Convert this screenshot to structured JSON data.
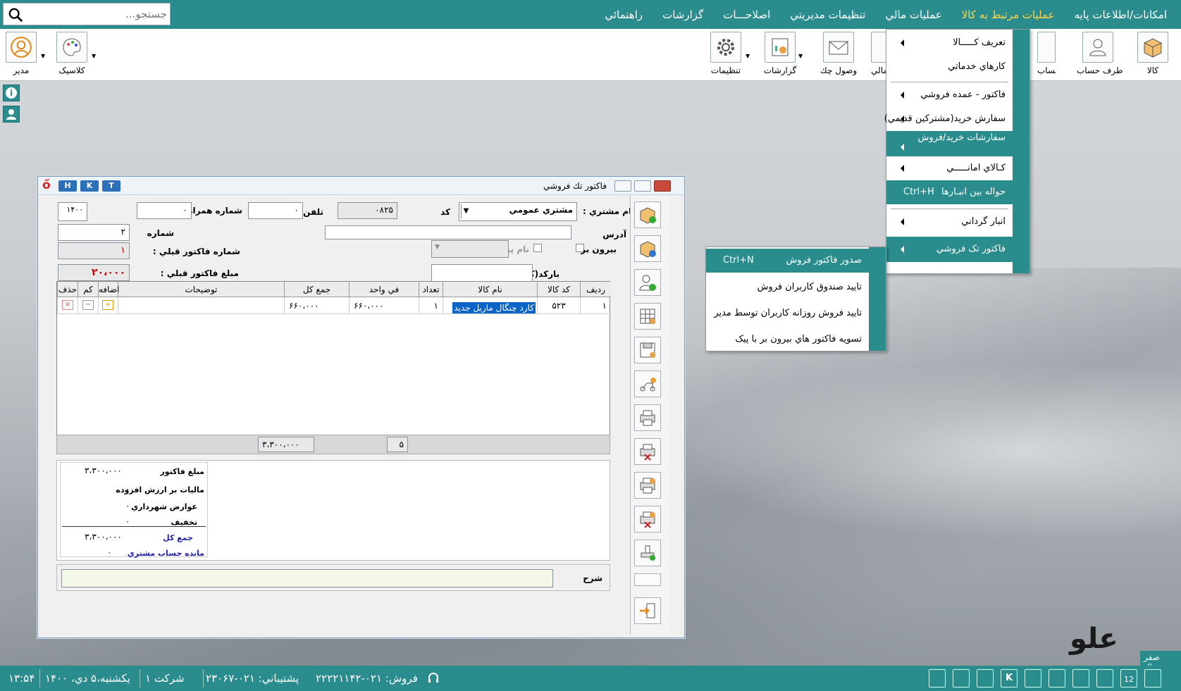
{
  "search": {
    "placeholder": "جستجو..."
  },
  "menu": [
    "امکانات/اطلاعات پایه",
    "عمليات مرتبط به کالا",
    "عمليات مالي",
    "تنظيمات مديريتي",
    "اصلاحـــات",
    "گزارشات",
    "راهنمائي"
  ],
  "toolbar": {
    "kala": "کالا",
    "taraf": "طرف حساب",
    "hesab": "حساب",
    "mali": "مالي",
    "vosool": "وصول چك",
    "gozareshat": "گزارشات",
    "tanzimat": "تنظيمات",
    "classic": "کلاسيک",
    "modir": "مدير"
  },
  "dropdown": [
    {
      "label": "تعريف کـــــالا",
      "arrow": true
    },
    {
      "label": "کارهاي خدماتي",
      "arrow": false
    },
    {
      "label": "فاکتور - عمده فروشي",
      "arrow": true
    },
    {
      "label": "سفارش خريد(مشترکين قديمي)",
      "arrow": true
    },
    {
      "label": "سفارشات خريد/فروش",
      "arrow": true
    },
    {
      "label": "کـالاي امانـــــي",
      "arrow": true
    },
    {
      "label": "حواله بين انبـارها",
      "shortcut": "Ctrl+H"
    },
    {
      "label": "انبار گرداني",
      "arrow": true
    },
    {
      "label": "فاکتور تک فروشي",
      "arrow": true
    }
  ],
  "submenu": [
    {
      "label": "صدور فاکتور فروش",
      "shortcut": "Ctrl+N"
    },
    {
      "label": "تاييد صندوق کاربران فروش"
    },
    {
      "label": "تاييد فروش روزانه کاربران توسط مدير"
    },
    {
      "label": "تسويه فاکتور هاي بيرون بر با پيک"
    }
  ],
  "window": {
    "title": "فاکتور تك فروشي",
    "hkt": [
      "H",
      "K",
      "T"
    ]
  },
  "form": {
    "customer_label": "نام مشتري :",
    "customer_value": "مشتري عمومي",
    "code_label": "کد",
    "code_value": "۰۸۲۵",
    "phone_label": "تلفن",
    "phone_value": "۰",
    "mobile_label": "شماره همراه",
    "mobile_value": "۰",
    "year_value": "۱۴۰۰",
    "address_label": "آدرس",
    "number_label": "شماره",
    "number_value": "۲",
    "outside_label": "بيرون بر",
    "courier_label": "نام پيک :",
    "prev_invoice_no_label": "شماره فاکتور قبلي :",
    "prev_invoice_no_value": "۱",
    "barcode_label": "بارکد(کالا/ترازو )",
    "prev_invoice_amount_label": "مبلغ فاکتور قبلي :",
    "prev_invoice_amount_value": "۲۰،۰۰۰"
  },
  "grid": {
    "headers": [
      "رديف",
      "کد کالا",
      "نام کالا",
      "تعداد",
      "في واحد",
      "جمع کل",
      "توضيحات",
      "اضافه",
      "کم",
      "حذف"
    ],
    "rows": [
      {
        "row": "۱",
        "code": "۵۲۳",
        "name": "کارد چنگال ماربل جديد",
        "qty": "۱",
        "unit": "۶۶۰،۰۰۰",
        "total": "۶۶۰،۰۰۰",
        "desc": ""
      }
    ],
    "footer_total": "۳،۳۰۰،۰۰۰",
    "footer_qty": "۵"
  },
  "summary": {
    "amount_label": "مبلغ فاکتور",
    "amount_value": "۳،۳۰۰،۰۰۰",
    "vat_label": "ماليات بر ارزش افزوده",
    "vat_value": "۰",
    "municipal_label": "عوارض شهرداري",
    "municipal_value": "۰",
    "discount_label": "تخفيف",
    "discount_value": "۰",
    "grand_label": "جمع کل",
    "grand_value": "۳،۳۰۰،۰۰۰",
    "balance_label": "مانده حساب مشتري",
    "balance_value": "۰"
  },
  "note": {
    "label": "شرح"
  },
  "status": {
    "time": "۱۳:۵۴",
    "date": "يكشنبه،۵ دي، ۱۴۰۰",
    "company": "شرکت ۱",
    "support": "پشتيباني: ۰۲۱-۲۳۰۶۷",
    "sales": "فروش: ۰۲۱-۲۲۲۲۱۱۴۲",
    "zero_rial": "صفر ريال"
  },
  "brand": {
    "name": "علو"
  },
  "colors": {
    "teal": "#2a8c8c",
    "active_menu": "#ffd54a",
    "selection": "#0a64c8"
  }
}
